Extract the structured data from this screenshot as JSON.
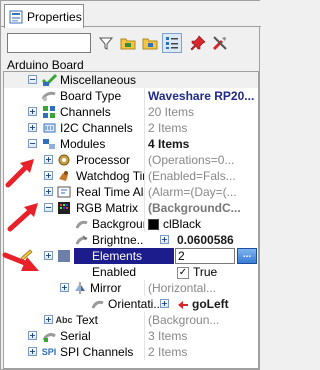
{
  "tab": {
    "label": "Properties"
  },
  "filter": {
    "value": "",
    "placeholder": ""
  },
  "board_label": "Arduino Board",
  "tree": {
    "miscellaneous": {
      "label": "Miscellaneous"
    },
    "board_type": {
      "name": "Board Type",
      "value": "Waveshare RP20..."
    },
    "channels": {
      "name": "Channels",
      "value": "20 Items"
    },
    "i2c_channels": {
      "name": "I2C Channels",
      "value": "2 Items"
    },
    "modules": {
      "name": "Modules",
      "value": "4 Items"
    },
    "processor": {
      "name": "Processor",
      "value": "(Operations=0..."
    },
    "watchdog": {
      "name": "Watchdog Tim...",
      "value": "(Enabled=Fals..."
    },
    "rtc": {
      "name": "Real Time Alar...",
      "value": "(Alarm=(Day=(..."
    },
    "rgb_matrix": {
      "name": "RGB Matrix",
      "value": "(BackgroundC..."
    },
    "background": {
      "name": "Backgroun...",
      "value": "clBlack"
    },
    "brightness": {
      "name": "Brightne...",
      "value": "0.0600586"
    },
    "elements": {
      "name": "Elements",
      "value": "2",
      "button": "..."
    },
    "enabled": {
      "name": "Enabled",
      "value": "True"
    },
    "mirror": {
      "name": "Mirror",
      "value": "(Horizontal..."
    },
    "orientation": {
      "name": "Orientati...",
      "value": "goLeft"
    },
    "text": {
      "name": "Text",
      "value": "(Backgroun..."
    },
    "serial": {
      "name": "Serial",
      "value": "3 Items"
    },
    "spi_channels": {
      "name": "SPI Channels",
      "value": "2 Items"
    }
  },
  "colors": {
    "selection": "#1c1c8c",
    "arrow": "#e8202a",
    "value_navy": "#1f2a8a"
  }
}
